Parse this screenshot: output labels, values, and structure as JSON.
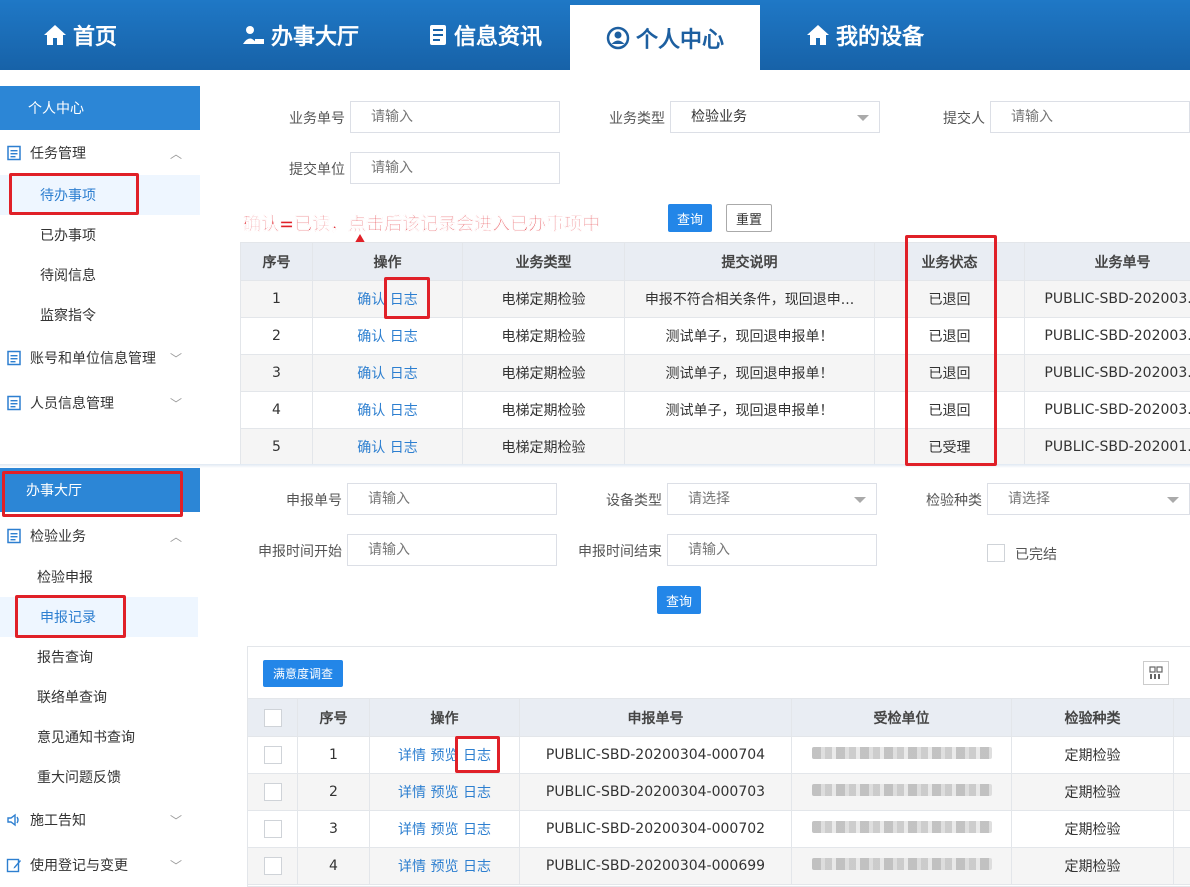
{
  "nav": {
    "items": [
      {
        "label": "首页",
        "icon": "home-icon"
      },
      {
        "label": "办事大厅",
        "icon": "person-desk-icon"
      },
      {
        "label": "信息资讯",
        "icon": "news-icon"
      },
      {
        "label": "个人中心",
        "icon": "user-circle-icon"
      },
      {
        "label": "我的设备",
        "icon": "home-icon"
      }
    ],
    "active": "个人中心"
  },
  "sidebar_top": {
    "head": "个人中心",
    "groups": [
      {
        "label": "任务管理",
        "items": [
          "待办事项",
          "已办事项",
          "待阅信息",
          "监察指令"
        ]
      },
      {
        "label": "账号和单位信息管理"
      },
      {
        "label": "人员信息管理"
      }
    ]
  },
  "filter_top": {
    "biz_no_label": "业务单号",
    "biz_no_placeholder": "请输入",
    "biz_type_label": "业务类型",
    "biz_type_value": "检验业务",
    "submitter_label": "提交人",
    "submitter_placeholder": "请输入",
    "unit_label": "提交单位",
    "unit_placeholder": "请输入",
    "query_btn": "查询",
    "reset_btn": "重置"
  },
  "annotation": "确认=已读，点击后该记录会进入已办事项中",
  "table_top": {
    "headers": [
      "序号",
      "操作",
      "业务类型",
      "提交说明",
      "业务状态",
      "业务单号"
    ],
    "action_confirm": "确认",
    "action_log": "日志",
    "rows": [
      {
        "no": "1",
        "type": "电梯定期检验",
        "desc": "申报不符合相关条件，现回退申...",
        "status": "已退回",
        "id": "PUBLIC-SBD-202003..."
      },
      {
        "no": "2",
        "type": "电梯定期检验",
        "desc": "测试单子，现回退申报单！",
        "status": "已退回",
        "id": "PUBLIC-SBD-202003..."
      },
      {
        "no": "3",
        "type": "电梯定期检验",
        "desc": "测试单子，现回退申报单！",
        "status": "已退回",
        "id": "PUBLIC-SBD-202003..."
      },
      {
        "no": "4",
        "type": "电梯定期检验",
        "desc": "测试单子，现回退申报单！",
        "status": "已退回",
        "id": "PUBLIC-SBD-202003..."
      },
      {
        "no": "5",
        "type": "电梯定期检验",
        "desc": "",
        "status": "已受理",
        "id": "PUBLIC-SBD-202001..."
      }
    ]
  },
  "sidebar_bottom": {
    "head": "办事大厅",
    "groups": [
      {
        "label": "检验业务",
        "items": [
          "检验申报",
          "申报记录",
          "报告查询",
          "联络单查询",
          "意见通知书查询",
          "重大问题反馈"
        ]
      },
      {
        "label": "施工告知"
      },
      {
        "label": "使用登记与变更"
      }
    ]
  },
  "filter_bottom": {
    "report_no_label": "申报单号",
    "report_no_placeholder": "请输入",
    "device_type_label": "设备类型",
    "device_type_placeholder": "请选择",
    "inspect_kind_label": "检验种类",
    "inspect_kind_placeholder": "请选择",
    "start_label": "申报时间开始",
    "start_placeholder": "请输入",
    "end_label": "申报时间结束",
    "end_placeholder": "请输入",
    "done_label": "已完结",
    "query_btn": "查询"
  },
  "table_bottom": {
    "survey_btn": "满意度调查",
    "headers": [
      "序号",
      "操作",
      "申报单号",
      "受检单位",
      "检验种类"
    ],
    "action_detail": "详情",
    "action_preview": "预览",
    "action_log": "日志",
    "rows": [
      {
        "no": "1",
        "id": "PUBLIC-SBD-20200304-000704",
        "kind": "定期检验"
      },
      {
        "no": "2",
        "id": "PUBLIC-SBD-20200304-000703",
        "kind": "定期检验"
      },
      {
        "no": "3",
        "id": "PUBLIC-SBD-20200304-000702",
        "kind": "定期检验"
      },
      {
        "no": "4",
        "id": "PUBLIC-SBD-20200304-000699",
        "kind": "定期检验"
      }
    ]
  },
  "colors": {
    "nav_bg": "#1762a8",
    "accent": "#2386e8",
    "annotation": "#e02028"
  }
}
